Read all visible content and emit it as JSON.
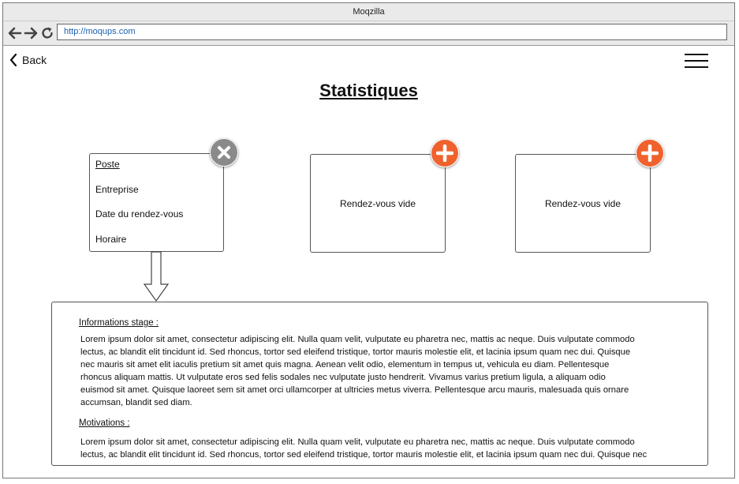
{
  "window": {
    "title": "Moqzilla"
  },
  "browser": {
    "url": "http://moqups.com",
    "back_icon": "arrow-left-icon",
    "forward_icon": "arrow-right-icon",
    "reload_icon": "reload-icon"
  },
  "header": {
    "back_label": "Back",
    "menu_icon": "hamburger-menu-icon"
  },
  "page": {
    "title": "Statistiques"
  },
  "cards": [
    {
      "fields": [
        "Poste",
        "Entreprise",
        "Date du rendez-vous",
        "Horaire"
      ],
      "badge_icon": "close-icon",
      "badge_color": "#8a8a8a"
    },
    {
      "label": "Rendez-vous vide",
      "badge_icon": "plus-icon",
      "badge_color": "#f0622d"
    },
    {
      "label": "Rendez-vous vide",
      "badge_icon": "plus-icon",
      "badge_color": "#f0622d"
    }
  ],
  "details": {
    "sections": [
      {
        "heading": "Informations stage :",
        "text": "Lorem ipsum dolor sit amet, consectetur adipiscing elit. Nulla quam velit, vulputate eu pharetra nec, mattis ac neque. Duis vulputate commodo\nlectus, ac blandit elit tincidunt id. Sed rhoncus, tortor sed eleifend tristique, tortor mauris molestie elit, et lacinia ipsum quam nec dui. Quisque\nnec mauris sit amet elit iaculis pretium sit amet quis magna. Aenean velit odio, elementum in tempus ut, vehicula eu diam. Pellentesque\nrhoncus aliquam mattis. Ut vulputate eros sed felis sodales nec vulputate justo hendrerit. Vivamus varius pretium ligula, a aliquam odio\neuismod sit amet. Quisque laoreet sem sit amet orci ullamcorper at ultricies metus viverra. Pellentesque arcu mauris, malesuada quis ornare\naccumsan, blandit sed diam."
      },
      {
        "heading": "Motivations :",
        "text": "Lorem ipsum dolor sit amet, consectetur adipiscing elit. Nulla quam velit, vulputate eu pharetra nec, mattis ac neque. Duis vulputate commodo\nlectus, ac blandit elit tincidunt id. Sed rhoncus, tortor sed eleifend tristique, tortor mauris molestie elit, et lacinia ipsum quam nec dui. Quisque nec"
      }
    ]
  },
  "colors": {
    "accent": "#f0622d",
    "close": "#8a8a8a",
    "url": "#1a5fb4"
  }
}
